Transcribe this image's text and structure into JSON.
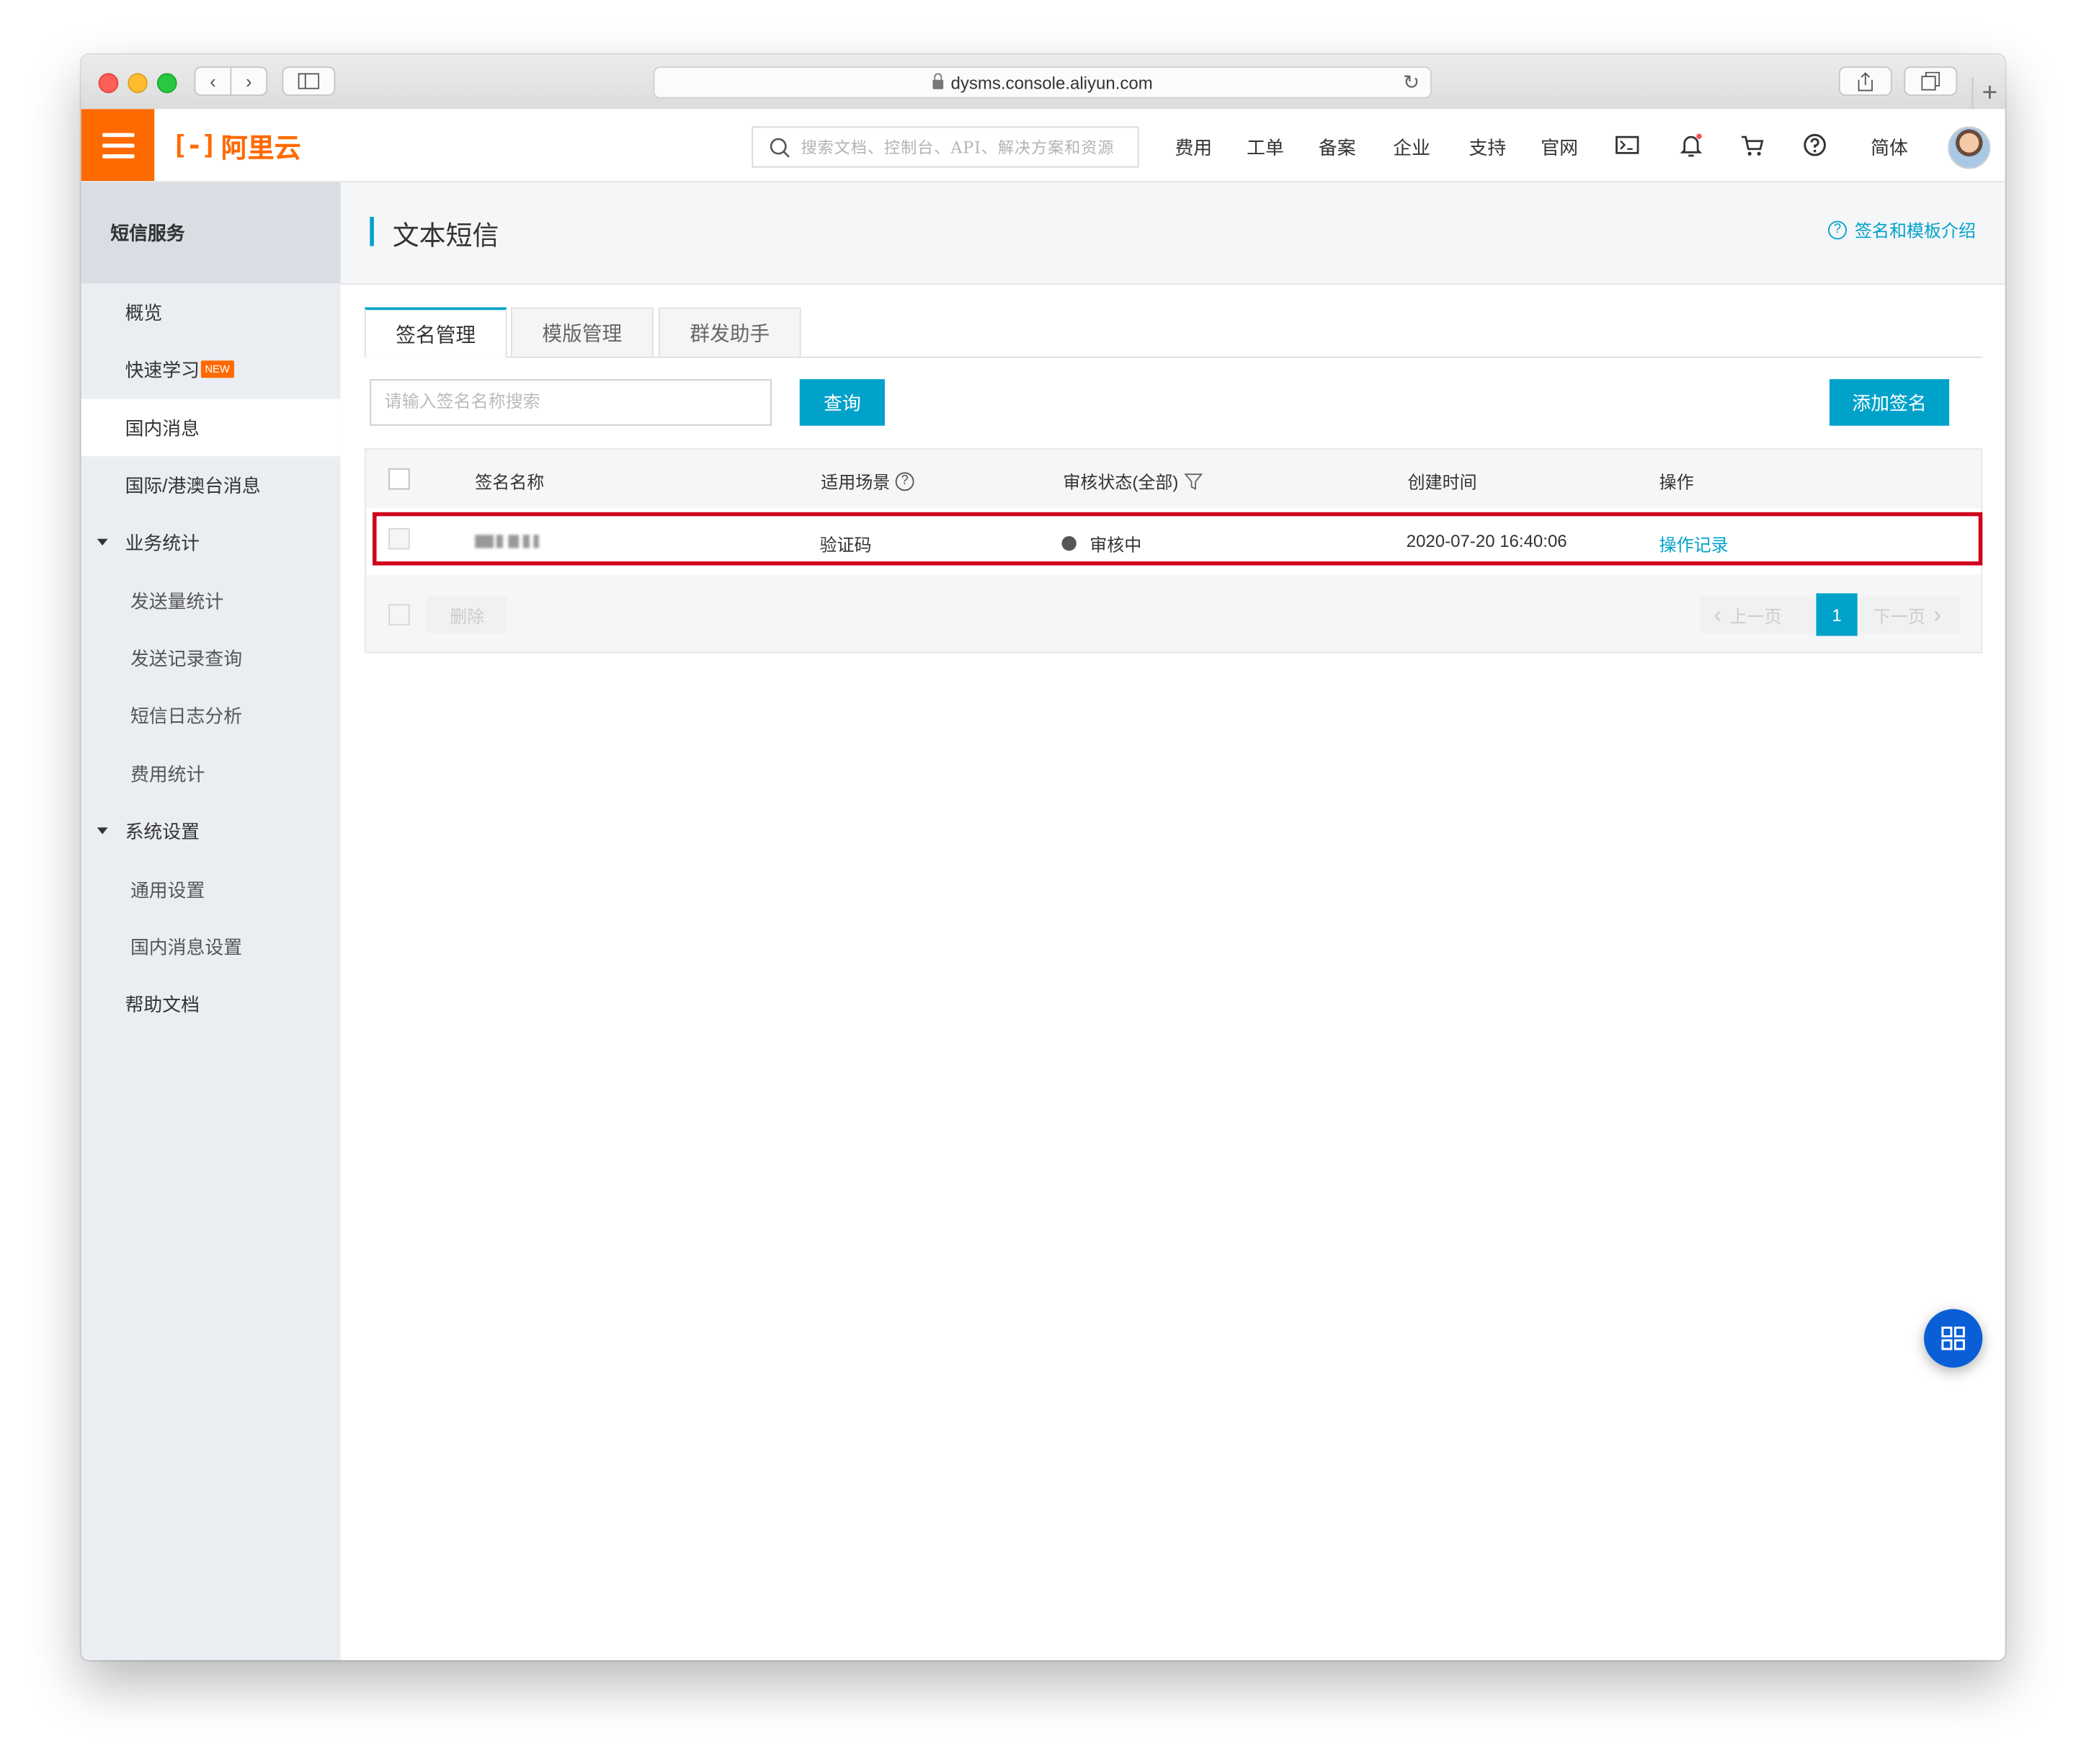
{
  "browser": {
    "url": "dysms.console.aliyun.com"
  },
  "header": {
    "logo_text": "阿里云",
    "logo_mark": "[-]",
    "search_placeholder": "搜索文档、控制台、API、解决方案和资源",
    "links": [
      "费用",
      "工单",
      "备案",
      "企业",
      "支持",
      "官网"
    ],
    "language": "简体",
    "accent_color": "#ff6a00"
  },
  "sidebar": {
    "title": "短信服务",
    "items": [
      {
        "label": "概览"
      },
      {
        "label": "快速学习",
        "badge": "NEW"
      },
      {
        "label": "国内消息"
      },
      {
        "label": "国际/港澳台消息"
      },
      {
        "label": "业务统计"
      },
      {
        "label": "发送量统计"
      },
      {
        "label": "发送记录查询"
      },
      {
        "label": "短信日志分析"
      },
      {
        "label": "费用统计"
      },
      {
        "label": "系统设置"
      },
      {
        "label": "通用设置"
      },
      {
        "label": "国内消息设置"
      },
      {
        "label": "帮助文档"
      }
    ]
  },
  "page": {
    "title": "文本短信",
    "help_link": "签名和模板介绍",
    "tabs": [
      "签名管理",
      "模版管理",
      "群发助手"
    ],
    "search_placeholder": "请输入签名名称搜索",
    "query_button": "查询",
    "add_button": "添加签名",
    "primary_color": "#00a2ca"
  },
  "table": {
    "columns": [
      "签名名称",
      "适用场景",
      "审核状态(全部)",
      "创建时间",
      "操作"
    ],
    "rows": [
      {
        "scene": "验证码",
        "status": "审核中",
        "created": "2020-07-20 16:40:06",
        "action": "操作记录"
      }
    ],
    "delete_button": "删除",
    "prev_page": "上一页",
    "current_page": "1",
    "next_page": "下一页",
    "highlight_color": "#d0021b"
  }
}
